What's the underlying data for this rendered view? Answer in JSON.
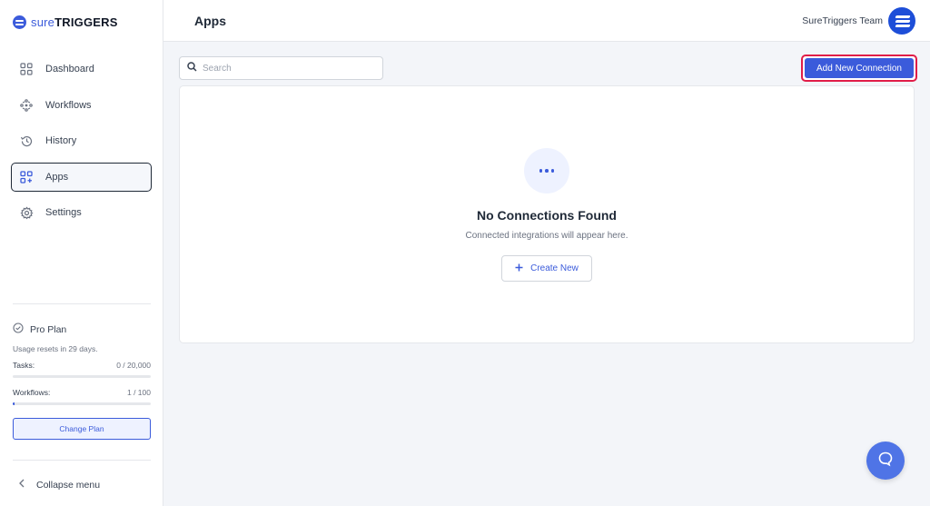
{
  "brand": {
    "logo_prefix": "sure",
    "logo_suffix": "TRIGGERS",
    "accent": "#3b5bdb"
  },
  "sidebar": {
    "items": [
      {
        "label": "Dashboard",
        "icon": "grid-icon"
      },
      {
        "label": "Workflows",
        "icon": "workflow-icon"
      },
      {
        "label": "History",
        "icon": "history-icon"
      },
      {
        "label": "Apps",
        "icon": "apps-icon",
        "active": true
      },
      {
        "label": "Settings",
        "icon": "gear-icon"
      }
    ],
    "plan": {
      "title": "Pro Plan",
      "reset_text": "Usage resets in 29 days.",
      "tasks_label": "Tasks:",
      "tasks_value": "0 / 20,000",
      "tasks_fraction": 0,
      "workflows_label": "Workflows:",
      "workflows_value": "1 / 100",
      "workflows_fraction": 0.01,
      "change_plan_label": "Change Plan"
    },
    "collapse_label": "Collapse menu"
  },
  "header": {
    "title": "Apps",
    "user_name": "SureTriggers Team"
  },
  "toolbar": {
    "search_placeholder": "Search",
    "add_connection_label": "Add New Connection"
  },
  "empty_state": {
    "title": "No Connections Found",
    "subtitle": "Connected integrations will appear here.",
    "create_label": "Create New"
  }
}
